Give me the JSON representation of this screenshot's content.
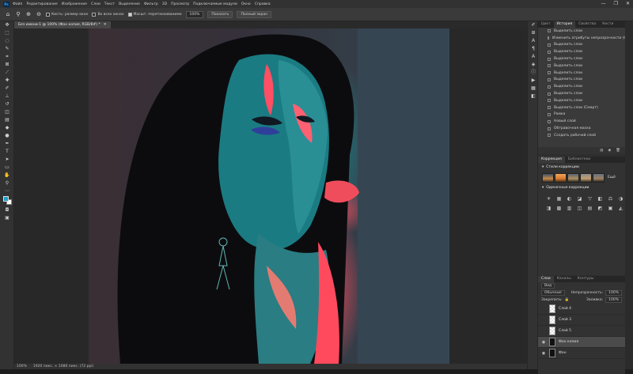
{
  "app": {
    "logo": "Ps"
  },
  "menu": [
    "Файл",
    "Редактирование",
    "Изображение",
    "Слои",
    "Текст",
    "Выделение",
    "Фильтр",
    "3D",
    "Просмотр",
    "Подключаемые модули",
    "Окно",
    "Справка"
  ],
  "window_controls": [
    "—",
    "❐",
    "✕"
  ],
  "options": {
    "checkbox1": "Кисть: размер окон",
    "checkbox2": "Во всех окнах",
    "checkbox3": "Масшт. перетаскиванием",
    "zoom_value": "100%",
    "fit_button": "Показать",
    "fill_button": "Полный экран"
  },
  "document": {
    "tab_title": "Без имени-1 @ 100% (Фон копия, RGB/8#) *",
    "tab_close": "✕"
  },
  "status": {
    "zoom": "100%",
    "info": "1920 пикс. × 1080 пикс. (72 ppi)"
  },
  "history": {
    "tabs": [
      "Цвет",
      "История",
      "Свойства",
      "Кисти"
    ],
    "items": [
      "Выделить слои",
      "Изменить атрибуты непрозрачности (Смарт)",
      "Выделить слои",
      "Выделить слои",
      "Выделить слои",
      "Выделить слои",
      "Выделить слои",
      "Выделить слои",
      "Выделить слои",
      "Выделить слои",
      "Выделить слои",
      "Выделить слои (Смарт)",
      "Рамка",
      "Новый слой",
      "Обтравочная маска",
      "Создать рабочий слой"
    ]
  },
  "adjustments": {
    "tabs": [
      "Коррекция",
      "Библиотеки"
    ],
    "presets_title": "Стили коррекции",
    "presets_more": "Ещё",
    "single_title": "Одиночные коррекции",
    "icons": [
      "☀",
      "▦",
      "◐",
      "◪",
      "▽",
      "◧",
      "⚖",
      "◑",
      "◨",
      "▩",
      "▥",
      "◫",
      "▤",
      "◩",
      "▣",
      "◭"
    ]
  },
  "layers": {
    "tabs": [
      "Слои",
      "Каналы",
      "Контуры"
    ],
    "filter_label": "Вид",
    "blend_mode": "Обычные",
    "opacity_label": "Непрозрачность:",
    "opacity_value": "100%",
    "lock_label": "Закрепить:",
    "fill_label": "Заливка:",
    "fill_value": "100%",
    "items": [
      {
        "name": "Слой 4",
        "visible": false,
        "selected": false,
        "thumb": "transparent"
      },
      {
        "name": "Слой 3",
        "visible": false,
        "selected": false,
        "thumb": "transparent"
      },
      {
        "name": "Слой 5",
        "visible": false,
        "selected": false,
        "thumb": "transparent"
      },
      {
        "name": "Фон копия",
        "visible": true,
        "selected": true,
        "thumb": "dark"
      },
      {
        "name": "Фон",
        "visible": true,
        "selected": false,
        "thumb": "dark"
      }
    ]
  },
  "colors": {
    "foreground": "#1aa1c9",
    "background": "#ffffff"
  }
}
